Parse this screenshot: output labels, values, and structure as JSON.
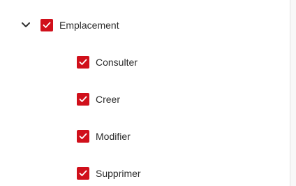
{
  "tree": {
    "parent": {
      "label": "Emplacement",
      "checked": true,
      "expanded": true,
      "expand_icon": "chevron-down-icon"
    },
    "children": [
      {
        "label": "Consulter",
        "checked": true
      },
      {
        "label": "Creer",
        "checked": true
      },
      {
        "label": "Modifier",
        "checked": true
      },
      {
        "label": "Supprimer",
        "checked": true
      }
    ]
  },
  "colors": {
    "checkbox_fill": "#d0101b",
    "checkmark": "#ffffff",
    "text": "#2b2b2b"
  }
}
